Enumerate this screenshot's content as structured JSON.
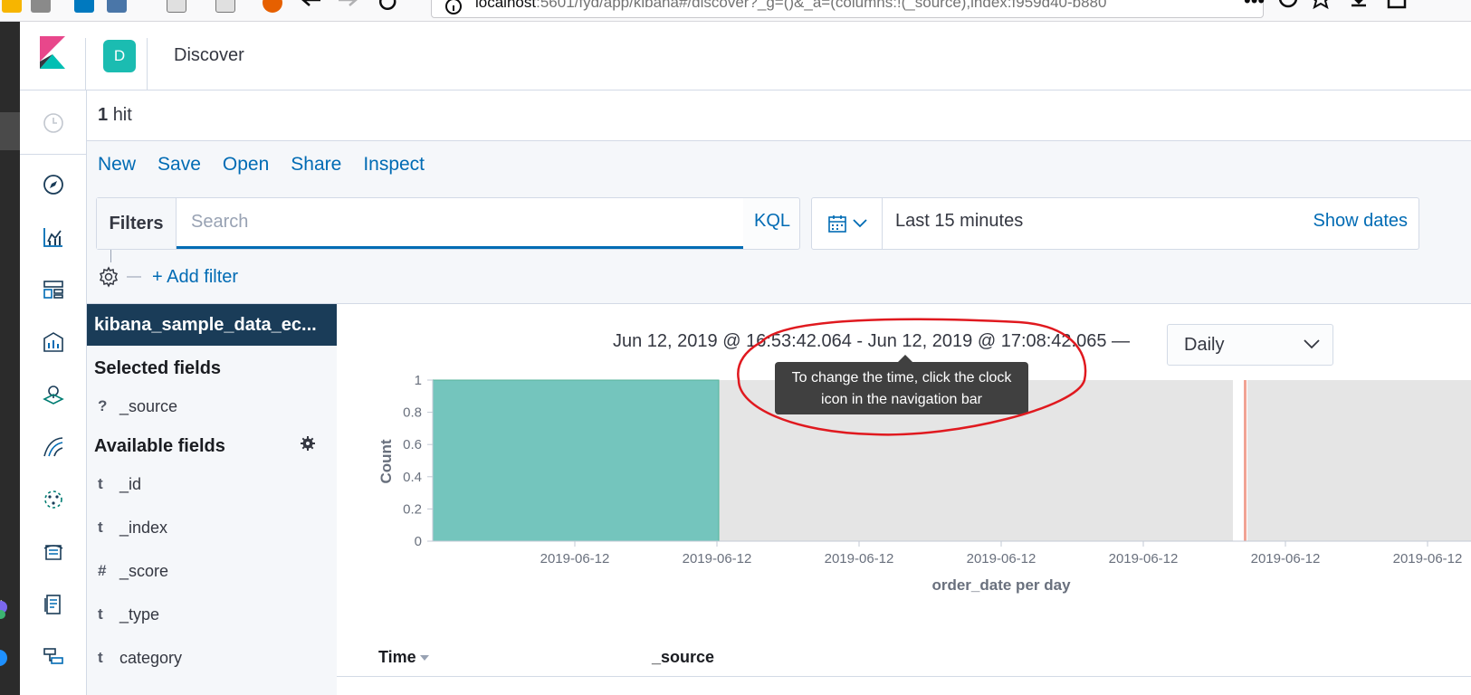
{
  "browser": {
    "url_host": "localhost",
    "url_rest": ":5601/fyd/app/kibana#/discover?_g=()&_a=(columns:!(_source),index:f959d40-b880"
  },
  "header": {
    "space_initial": "D",
    "app_title": "Discover"
  },
  "nav": {
    "items": [
      "recently-viewed",
      "discover",
      "visualize",
      "dashboard",
      "canvas",
      "maps",
      "ml",
      "infrastructure",
      "logs",
      "apm",
      "uptime",
      "dev-tools"
    ]
  },
  "hits": {
    "count": "1",
    "label": "hit"
  },
  "top_menu": [
    "New",
    "Save",
    "Open",
    "Share",
    "Inspect"
  ],
  "query": {
    "filters_label": "Filters",
    "search_placeholder": "Search",
    "language": "KQL"
  },
  "time_picker": {
    "label": "Last 15 minutes",
    "show_dates": "Show dates"
  },
  "filter_row": {
    "add_filter": "+ Add filter"
  },
  "sidebar": {
    "index_pattern": "kibana_sample_data_ec...",
    "selected_title": "Selected fields",
    "selected": [
      {
        "type": "?",
        "name": "_source"
      }
    ],
    "available_title": "Available fields",
    "available": [
      {
        "type": "t",
        "name": "_id"
      },
      {
        "type": "t",
        "name": "_index"
      },
      {
        "type": "#",
        "name": "_score"
      },
      {
        "type": "t",
        "name": "_type"
      },
      {
        "type": "t",
        "name": "category"
      }
    ]
  },
  "chart": {
    "range_text": "Jun 12, 2019 @ 16:53:42.064 - Jun 12, 2019 @ 17:08:42.065 —",
    "interval": "Daily",
    "tooltip_line1": "To change the time, click the clock",
    "tooltip_line2": "icon in the navigation bar"
  },
  "chart_data": {
    "type": "bar",
    "xlabel": "order_date per day",
    "ylabel": "Count",
    "ylim": [
      0,
      1
    ],
    "yticks": [
      "0",
      "0.2",
      "0.4",
      "0.6",
      "0.8",
      "1"
    ],
    "xticks": [
      "2019-06-12",
      "2019-06-12",
      "2019-06-12",
      "2019-06-12",
      "2019-06-12",
      "2019-06-12",
      "2019-06-12"
    ],
    "values": [
      1
    ],
    "bar_color": "#74c5bd",
    "out_of_range_color": "#e5e5e5",
    "current_time_color": "#e7664c"
  },
  "table": {
    "col_time": "Time",
    "col_source": "_source"
  },
  "colors": {
    "link": "#006bb4",
    "index_pattern_bg": "#1a3c58",
    "annotation": "#e0191f"
  }
}
